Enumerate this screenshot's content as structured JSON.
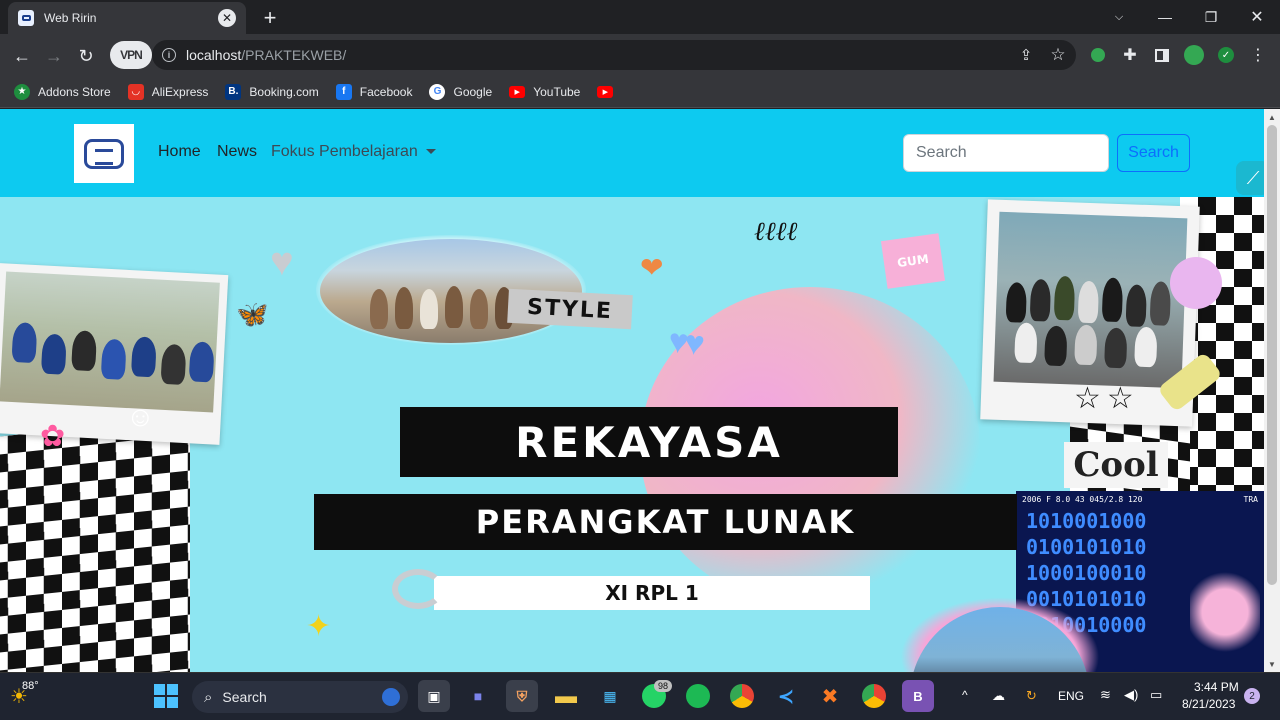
{
  "browser": {
    "tab_title": "Web Ririn",
    "url_host": "localhost",
    "url_path": "/PRAKTEKWEB/",
    "vpn_label": "VPN",
    "bookmarks": [
      {
        "label": "Addons Store",
        "icon": "addons-store-icon",
        "color": "#1e8e3e"
      },
      {
        "label": "AliExpress",
        "icon": "aliexpress-icon",
        "color": "#e43225"
      },
      {
        "label": "Booking.com",
        "icon": "booking-icon",
        "color": "#003580"
      },
      {
        "label": "Facebook",
        "icon": "facebook-icon",
        "color": "#1877f2"
      },
      {
        "label": "Google",
        "icon": "google-icon",
        "color": "#ffffff"
      },
      {
        "label": "YouTube",
        "icon": "youtube-icon",
        "color": "#ff0000"
      }
    ]
  },
  "site": {
    "nav": {
      "home": "Home",
      "news": "News",
      "dropdown": "Fokus Pembelajaran",
      "search_placeholder": "Search",
      "search_button": "Search"
    },
    "hero": {
      "line1": "REKAYASA",
      "line2": "PERANGKAT LUNAK",
      "class_label": "XI RPL 1",
      "sticker_style": "STYLE",
      "sticker_cool": "Cool",
      "sticker_gum": "GUM",
      "binary_rows": [
        "1010001000",
        "0100101010",
        "1000100010",
        "0010101010",
        "1010010000"
      ],
      "code_overlay": "2006 F 8.0    43   045/2.8 120",
      "code_overlay_right": "TRA"
    }
  },
  "taskbar": {
    "weather": "88°",
    "search_label": "Search",
    "lang": "ENG",
    "time": "3:44 PM",
    "date": "8/21/2023",
    "notifications": "2",
    "badge_count": "98"
  },
  "colors": {
    "navbar": "#0dcaf0",
    "hero_bg": "#8ee6f2",
    "search_outline": "#0d6efd"
  }
}
